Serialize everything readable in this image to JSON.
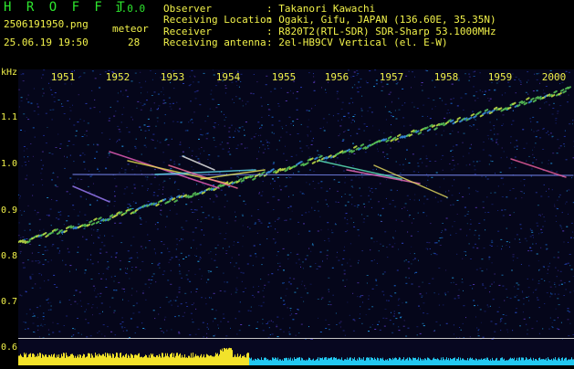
{
  "app": {
    "name": "H R O F F T",
    "version": "1.0.0",
    "file_name": "2506191950.png",
    "timestamp": "25.06.19 19:50",
    "count_label": "meteor",
    "count_value": "28"
  },
  "info": {
    "observer_label": "Observer",
    "observer_value": ": Takanori Kawachi",
    "location_label": "Receiving Location",
    "location_value": ": Ogaki, Gifu, JAPAN (136.60E, 35.35N)",
    "receiver_label": "Receiver",
    "receiver_value": ": R820T2(RTL-SDR) SDR-Sharp 53.1000MHz",
    "antenna_label": "Receiving antenna",
    "antenna_value": ": 2el-HB9CV Vertical (el. E-W)"
  },
  "axes": {
    "unit_label": "kHz",
    "y_ticks": [
      "1.1",
      "1.0",
      "0.9",
      "0.8",
      "0.7",
      "0.6"
    ],
    "x_ticks": [
      "1951",
      "1952",
      "1953",
      "1954",
      "1955",
      "1956",
      "1957",
      "1958",
      "1959",
      "2000"
    ]
  },
  "colors": {
    "text_green": "#2ee62e",
    "text_yellow": "#f2f24a",
    "background_spectrum": "#05061a",
    "level_yellow": "#f2e22a",
    "level_cyan": "#22c8f0"
  }
}
